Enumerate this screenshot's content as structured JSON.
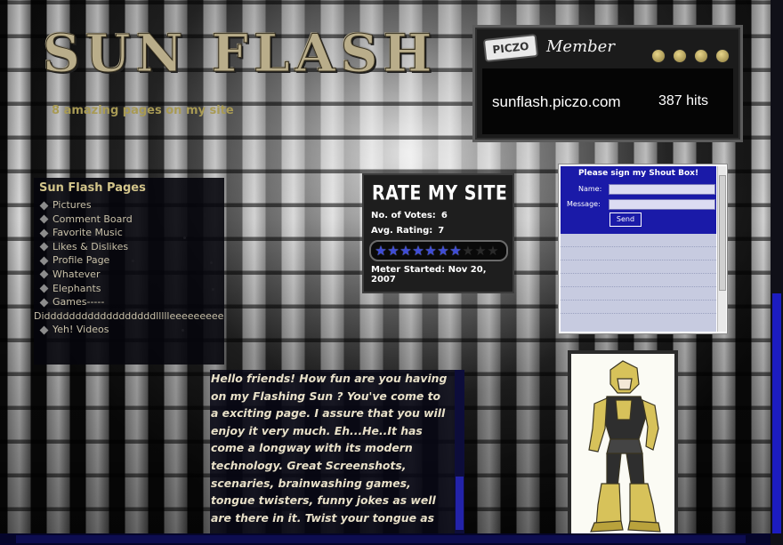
{
  "site": {
    "title": "SUN FLASH",
    "tagline": "8 amazing pages on my site"
  },
  "member_widget": {
    "badge": "PICZO",
    "label": "Member",
    "url": "sunflash.piczo.com",
    "hits": "387 hits"
  },
  "nav": {
    "title": "Sun Flash Pages",
    "items": [
      {
        "label": "Pictures"
      },
      {
        "label": "Comment Board"
      },
      {
        "label": "Favorite Music"
      },
      {
        "label": "Likes & Dislikes"
      },
      {
        "label": "Profile Page"
      },
      {
        "label": "Whatever"
      },
      {
        "label": "Elephants"
      },
      {
        "label": "Games-----"
      },
      {
        "label": "Diddddddddddddddddddllllleeeeeeeee"
      },
      {
        "label": "Yeh! Videos"
      }
    ]
  },
  "rating": {
    "title": "RATE MY SITE",
    "votes_label": "No. of Votes:",
    "votes_value": "6",
    "avg_label": "Avg. Rating:",
    "avg_value": "7",
    "stars_on": 7,
    "stars_total": 10,
    "meter_started": "Meter Started: Nov 20, 2007"
  },
  "shoutbox": {
    "title": "Please sign my Shout Box!",
    "name_label": "Name:",
    "message_label": "Message:",
    "send_label": "Send"
  },
  "welcome": {
    "text": "Hello friends! How fun are you having on my Flashing Sun ? You've come to a exciting page. I assure that you will enjoy it very much. Eh...He..It has come a longway with its modern technology. Great Screenshots, scenaries, brainwashing games, tongue twisters, funny jokes as well are there in it. Twist your tongue as"
  },
  "colors": {
    "logo": "#b9ad8a",
    "tagline": "#a89a54",
    "nav_title": "#d2c48a",
    "shout_blue": "#1a1aa8",
    "star_on": "#3e4cd6"
  }
}
